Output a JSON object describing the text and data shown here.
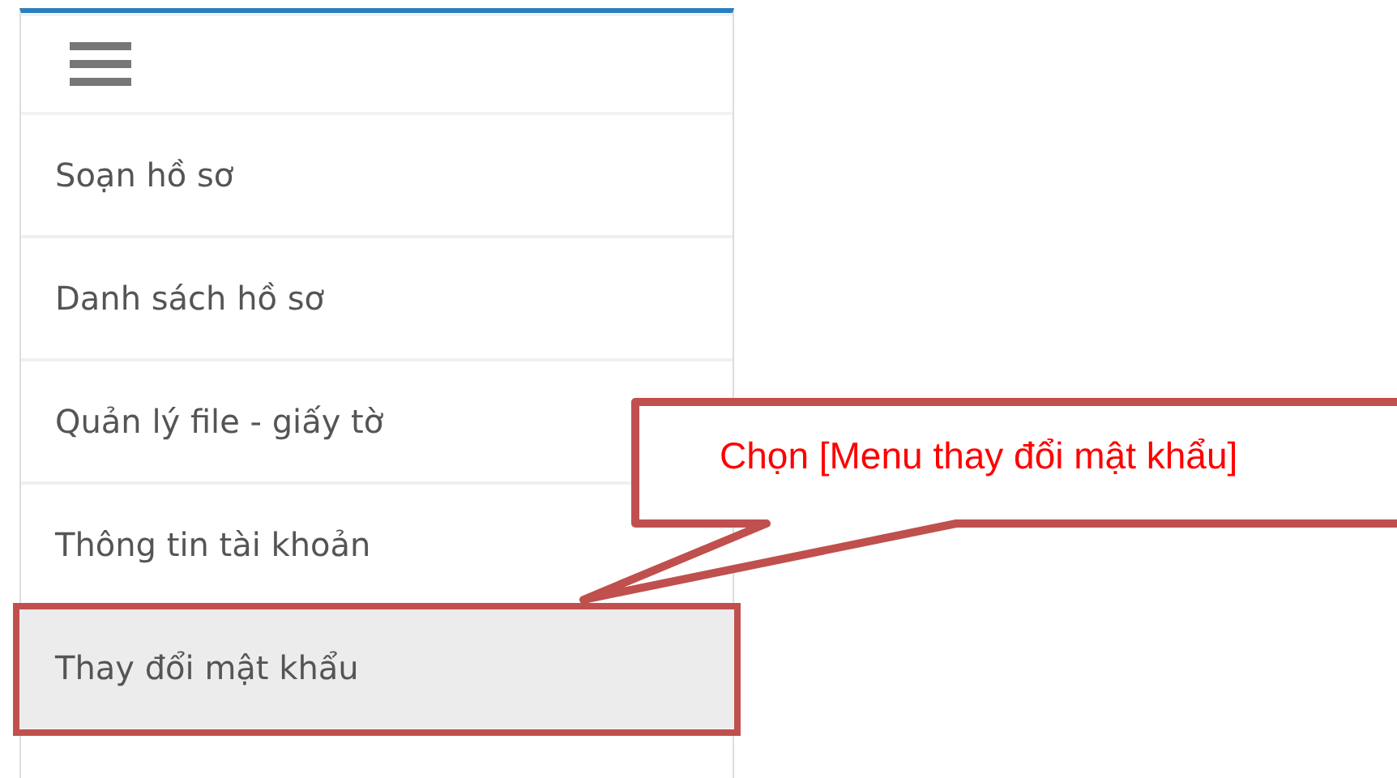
{
  "menu": {
    "items": [
      {
        "label": "Soạn hồ sơ",
        "selected": false
      },
      {
        "label": "Danh sách hồ sơ",
        "selected": false
      },
      {
        "label": "Quản lý file - giấy tờ",
        "selected": false
      },
      {
        "label": "Thông tin tài khoản",
        "selected": false
      },
      {
        "label": "Thay đổi mật khẩu",
        "selected": true
      }
    ]
  },
  "callout": {
    "text": "Chọn [Menu thay đổi mật khẩu]"
  }
}
